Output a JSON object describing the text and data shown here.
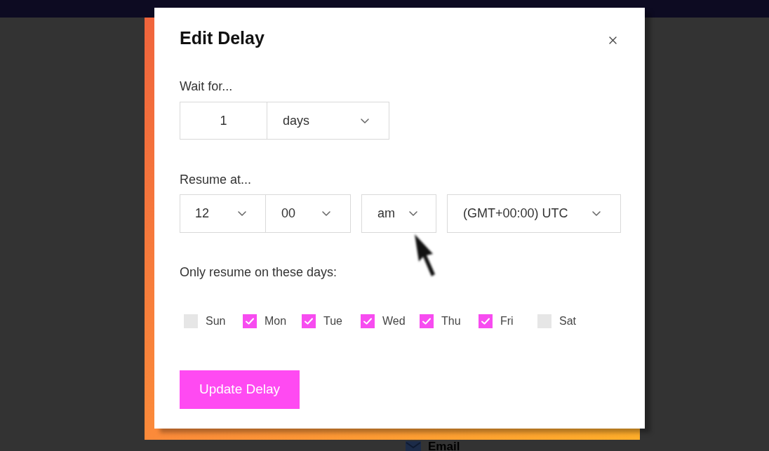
{
  "dialog": {
    "title": "Edit Delay",
    "wait_for": {
      "label": "Wait for...",
      "amount": "1",
      "unit": "days"
    },
    "resume_at": {
      "label": "Resume at...",
      "hour": "12",
      "minute": "00",
      "period": "am",
      "timezone": "(GMT+00:00) UTC"
    },
    "days": {
      "label": "Only resume on these days:",
      "items": [
        {
          "label": "Sun",
          "checked": false
        },
        {
          "label": "Mon",
          "checked": true
        },
        {
          "label": "Tue",
          "checked": true
        },
        {
          "label": "Wed",
          "checked": true
        },
        {
          "label": "Thu",
          "checked": true
        },
        {
          "label": "Fri",
          "checked": true
        },
        {
          "label": "Sat",
          "checked": false
        }
      ]
    },
    "submit_button": "Update Delay"
  },
  "background": {
    "item_label": "Email"
  }
}
